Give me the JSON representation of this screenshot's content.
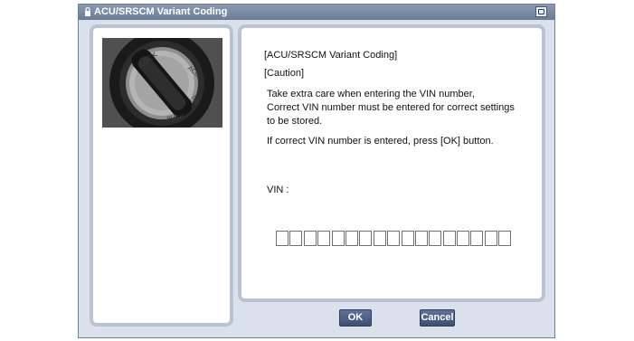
{
  "window": {
    "title": "ACU/SRSCM Variant Coding"
  },
  "left_panel": {
    "image": "ignition-key-switch-image"
  },
  "content": {
    "heading": "[ACU/SRSCM Variant Coding]",
    "caution": "[Caution]",
    "line1": "Take extra care when entering the VIN number,",
    "line2": "Correct VIN number must be entered for correct settings",
    "line3": "to be stored.",
    "line4": "If correct VIN number is entered, press [OK] button.",
    "vin_label": "VIN :",
    "vin_characters": 17
  },
  "buttons": {
    "ok": "OK",
    "cancel": "Cancel"
  },
  "colors": {
    "window_bg": "#dbe1ea",
    "titlebar": "#7a8aa2",
    "button": "#4a5f84",
    "panel_border": "#b9c3d2"
  }
}
